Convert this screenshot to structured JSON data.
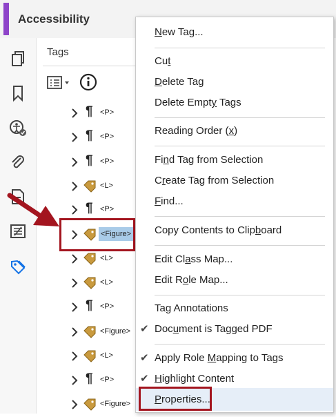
{
  "header": {
    "title": "Accessibility"
  },
  "rail": {
    "icons": [
      "pages-icon",
      "bookmark-icon",
      "accessibility-check-icon",
      "attachment-icon",
      "content-icon",
      "order-icon",
      "tags-icon"
    ]
  },
  "panel": {
    "title": "Tags"
  },
  "tree": [
    {
      "kind": "p",
      "label": "<P>"
    },
    {
      "kind": "p",
      "label": "<P>"
    },
    {
      "kind": "p",
      "label": "<P>"
    },
    {
      "kind": "tag",
      "label": "<L>"
    },
    {
      "kind": "p",
      "label": "<P>"
    },
    {
      "kind": "tag",
      "label": "<Figure>",
      "selected": true
    },
    {
      "kind": "tag",
      "label": "<L>"
    },
    {
      "kind": "tag",
      "label": "<L>"
    },
    {
      "kind": "p",
      "label": "<P>"
    },
    {
      "kind": "tag",
      "label": "<Figure>"
    },
    {
      "kind": "tag",
      "label": "<L>"
    },
    {
      "kind": "p",
      "label": "<P>"
    },
    {
      "kind": "tag",
      "label": "<Figure>"
    }
  ],
  "menu": {
    "new_tag": {
      "pre": "",
      "u": "N",
      "post": "ew Tag..."
    },
    "cut": {
      "pre": "Cu",
      "u": "t",
      "post": ""
    },
    "delete_tag": {
      "pre": "",
      "u": "D",
      "post": "elete Tag"
    },
    "delete_empty_tags": {
      "pre": "Delete Empt",
      "u": "y",
      "post": " Tags"
    },
    "reading_order": {
      "pre": "Reading Order (",
      "u": "x",
      "post": ")"
    },
    "find_tag": {
      "pre": "Fi",
      "u": "n",
      "post": "d Tag from Selection"
    },
    "create_tag": {
      "pre": "C",
      "u": "r",
      "post": "eate Tag from Selection"
    },
    "find": {
      "pre": "",
      "u": "F",
      "post": "ind..."
    },
    "copy_contents": {
      "pre": "Copy Contents to Clip",
      "u": "b",
      "post": "oard"
    },
    "edit_class_map": {
      "pre": "Edit Cl",
      "u": "a",
      "post": "ss Map..."
    },
    "edit_role_map": {
      "pre": "Edit R",
      "u": "o",
      "post": "le Map..."
    },
    "tag_annotations": {
      "pre": "Tag Annotations",
      "u": "",
      "post": ""
    },
    "document_tagged": {
      "pre": "Doc",
      "u": "u",
      "post": "ment is Tagged PDF"
    },
    "apply_role": {
      "pre": "Apply Role ",
      "u": "M",
      "post": "apping to Tags"
    },
    "highlight_content": {
      "pre": "",
      "u": "H",
      "post": "ighlight Content"
    },
    "properties": {
      "pre": "",
      "u": "P",
      "post": "roperties..."
    },
    "check_mark": "✔"
  },
  "colors": {
    "accent": "#8e44c9",
    "annotation": "#a3151f",
    "selection": "#a9cbe8",
    "hover": "#e6eef8"
  }
}
